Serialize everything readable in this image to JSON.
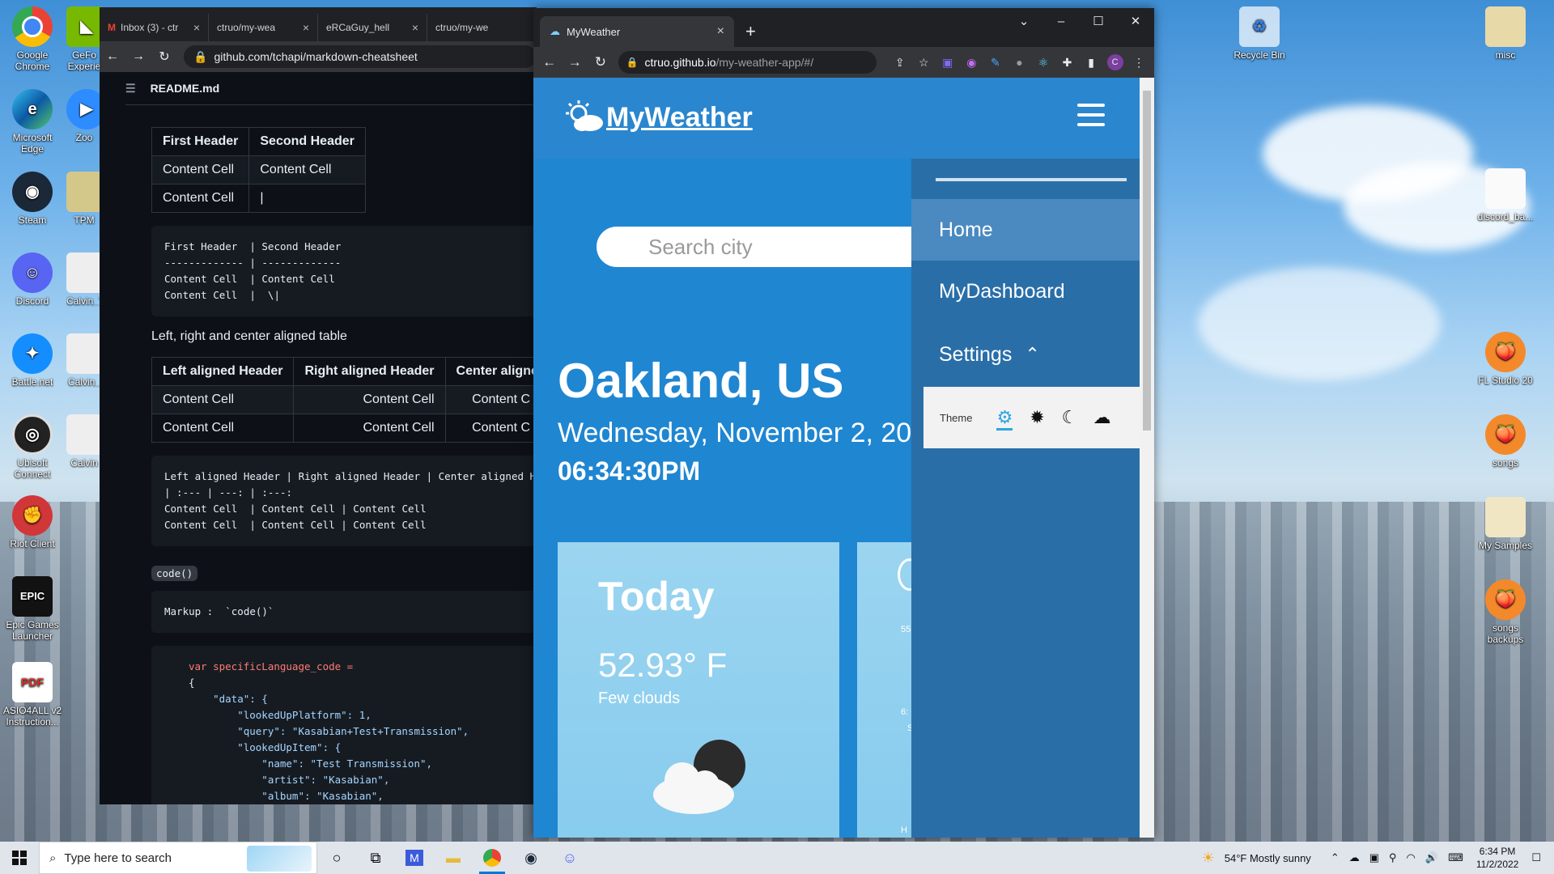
{
  "desktop": {
    "left_icons": [
      {
        "label": "Google Chrome",
        "icon": "chrome-icon",
        "color": "#e8453c"
      },
      {
        "label": "Microsoft Edge",
        "icon": "edge-icon",
        "color": "#1a9cd8"
      },
      {
        "label": "Steam",
        "icon": "steam-icon",
        "color": "#1b2838"
      },
      {
        "label": "Discord",
        "icon": "discord-icon",
        "color": "#5865f2"
      },
      {
        "label": "Battle.net",
        "icon": "battlenet-icon",
        "color": "#148eff"
      },
      {
        "label": "Ubisoft Connect",
        "icon": "ubisoft-icon",
        "color": "#222"
      },
      {
        "label": "Riot Client",
        "icon": "riot-icon",
        "color": "#d13639"
      },
      {
        "label": "Epic Games Launcher",
        "icon": "epic-icon",
        "color": "#121212"
      },
      {
        "label": "ASIO4ALL v2 Instruction...",
        "icon": "pdf-icon",
        "color": "#d93025"
      }
    ],
    "col2_icons": [
      {
        "label": "GeFo Experie",
        "icon": "geforce-icon",
        "color": "#76b900"
      },
      {
        "label": "Zoo",
        "icon": "zoom-icon",
        "color": "#2d8cff"
      },
      {
        "label": "TPM",
        "icon": "file-icon",
        "color": "#d4c78a"
      },
      {
        "label": "Calvin_T",
        "icon": "text-file-icon",
        "color": "#e8e8e8"
      },
      {
        "label": "Calvin_",
        "icon": "text-file-icon",
        "color": "#e8e8e8"
      },
      {
        "label": "Calvin",
        "icon": "text-file-icon",
        "color": "#e8e8e8"
      }
    ],
    "right_icons": [
      {
        "label": "Recycle Bin",
        "icon": "recycle-bin-icon"
      },
      {
        "label": "misc",
        "icon": "folder-icon"
      },
      {
        "label": "discord_ba...",
        "icon": "file-icon"
      },
      {
        "label": "FL Studio 20",
        "icon": "flstudio-icon"
      },
      {
        "label": "songs",
        "icon": "flstudio-icon"
      },
      {
        "label": "My Samples",
        "icon": "folder-icon"
      },
      {
        "label": "songs backups",
        "icon": "flstudio-icon"
      }
    ]
  },
  "taskbar": {
    "search_placeholder": "Type here to search",
    "weather": "54°F  Mostly sunny",
    "time": "6:34 PM",
    "date": "11/2/2022"
  },
  "github_window": {
    "tabs": [
      "Inbox (3) - ctr",
      "ctruo/my-wea",
      "eRCaGuy_hell",
      "ctruo/my-we"
    ],
    "url": "github.com/tchapi/markdown-cheatsheet",
    "file": "README.md",
    "table1": {
      "headers": [
        "First Header",
        "Second Header"
      ],
      "rows": [
        [
          "Content Cell",
          "Content Cell"
        ],
        [
          "Content Cell",
          "|"
        ]
      ]
    },
    "code1": "First Header  | Second Header\n------------- | -------------\nContent Cell  | Content Cell\nContent Cell  |  \\|",
    "paragraph": "Left, right and center aligned table",
    "table2": {
      "headers": [
        "Left aligned Header",
        "Right aligned Header",
        "Center aligned"
      ],
      "rows": [
        [
          "Content Cell",
          "Content Cell",
          "Content C"
        ],
        [
          "Content Cell",
          "Content Cell",
          "Content C"
        ]
      ]
    },
    "code2": "Left aligned Header | Right aligned Header | Center aligned H\n| :--- | ---: | :---:\nContent Cell  | Content Cell | Content Cell\nContent Cell  | Content Cell | Content Cell",
    "inline_code": "code()",
    "code3": "Markup :  `code()`",
    "code4_lines": [
      "var specificLanguage_code =",
      "{",
      "    \"data\": {",
      "        \"lookedUpPlatform\": 1,",
      "        \"query\": \"Kasabian+Test+Transmission\",",
      "        \"lookedUpItem\": {",
      "            \"name\": \"Test Transmission\",",
      "            \"artist\": \"Kasabian\",",
      "            \"album\": \"Kasabian\","
    ]
  },
  "weather_window": {
    "tab_title": "MyWeather",
    "url_host": "ctruo.github.io",
    "url_path": "/my-weather-app/#/",
    "app": {
      "logo": "MyWeather",
      "search_placeholder": "Search city",
      "city": "Oakland, US",
      "date": "Wednesday, November 2, 20",
      "time": "06:34:30PM",
      "today_label": "Today",
      "temperature": "52.93° F",
      "description": "Few clouds",
      "card2_fragments": [
        "55",
        "6:",
        "S",
        "H"
      ]
    },
    "menu": {
      "items": [
        "Home",
        "MyDashboard",
        "Settings"
      ],
      "theme_label": "Theme",
      "theme_icons": [
        "gear-icon",
        "sun-icon",
        "moon-icon",
        "cloud-icon"
      ]
    },
    "colors": {
      "header": "#2a86ce",
      "page": "#1f86d2",
      "menu": "#2a6ea8",
      "menu_active": "#4a8ac0"
    }
  }
}
